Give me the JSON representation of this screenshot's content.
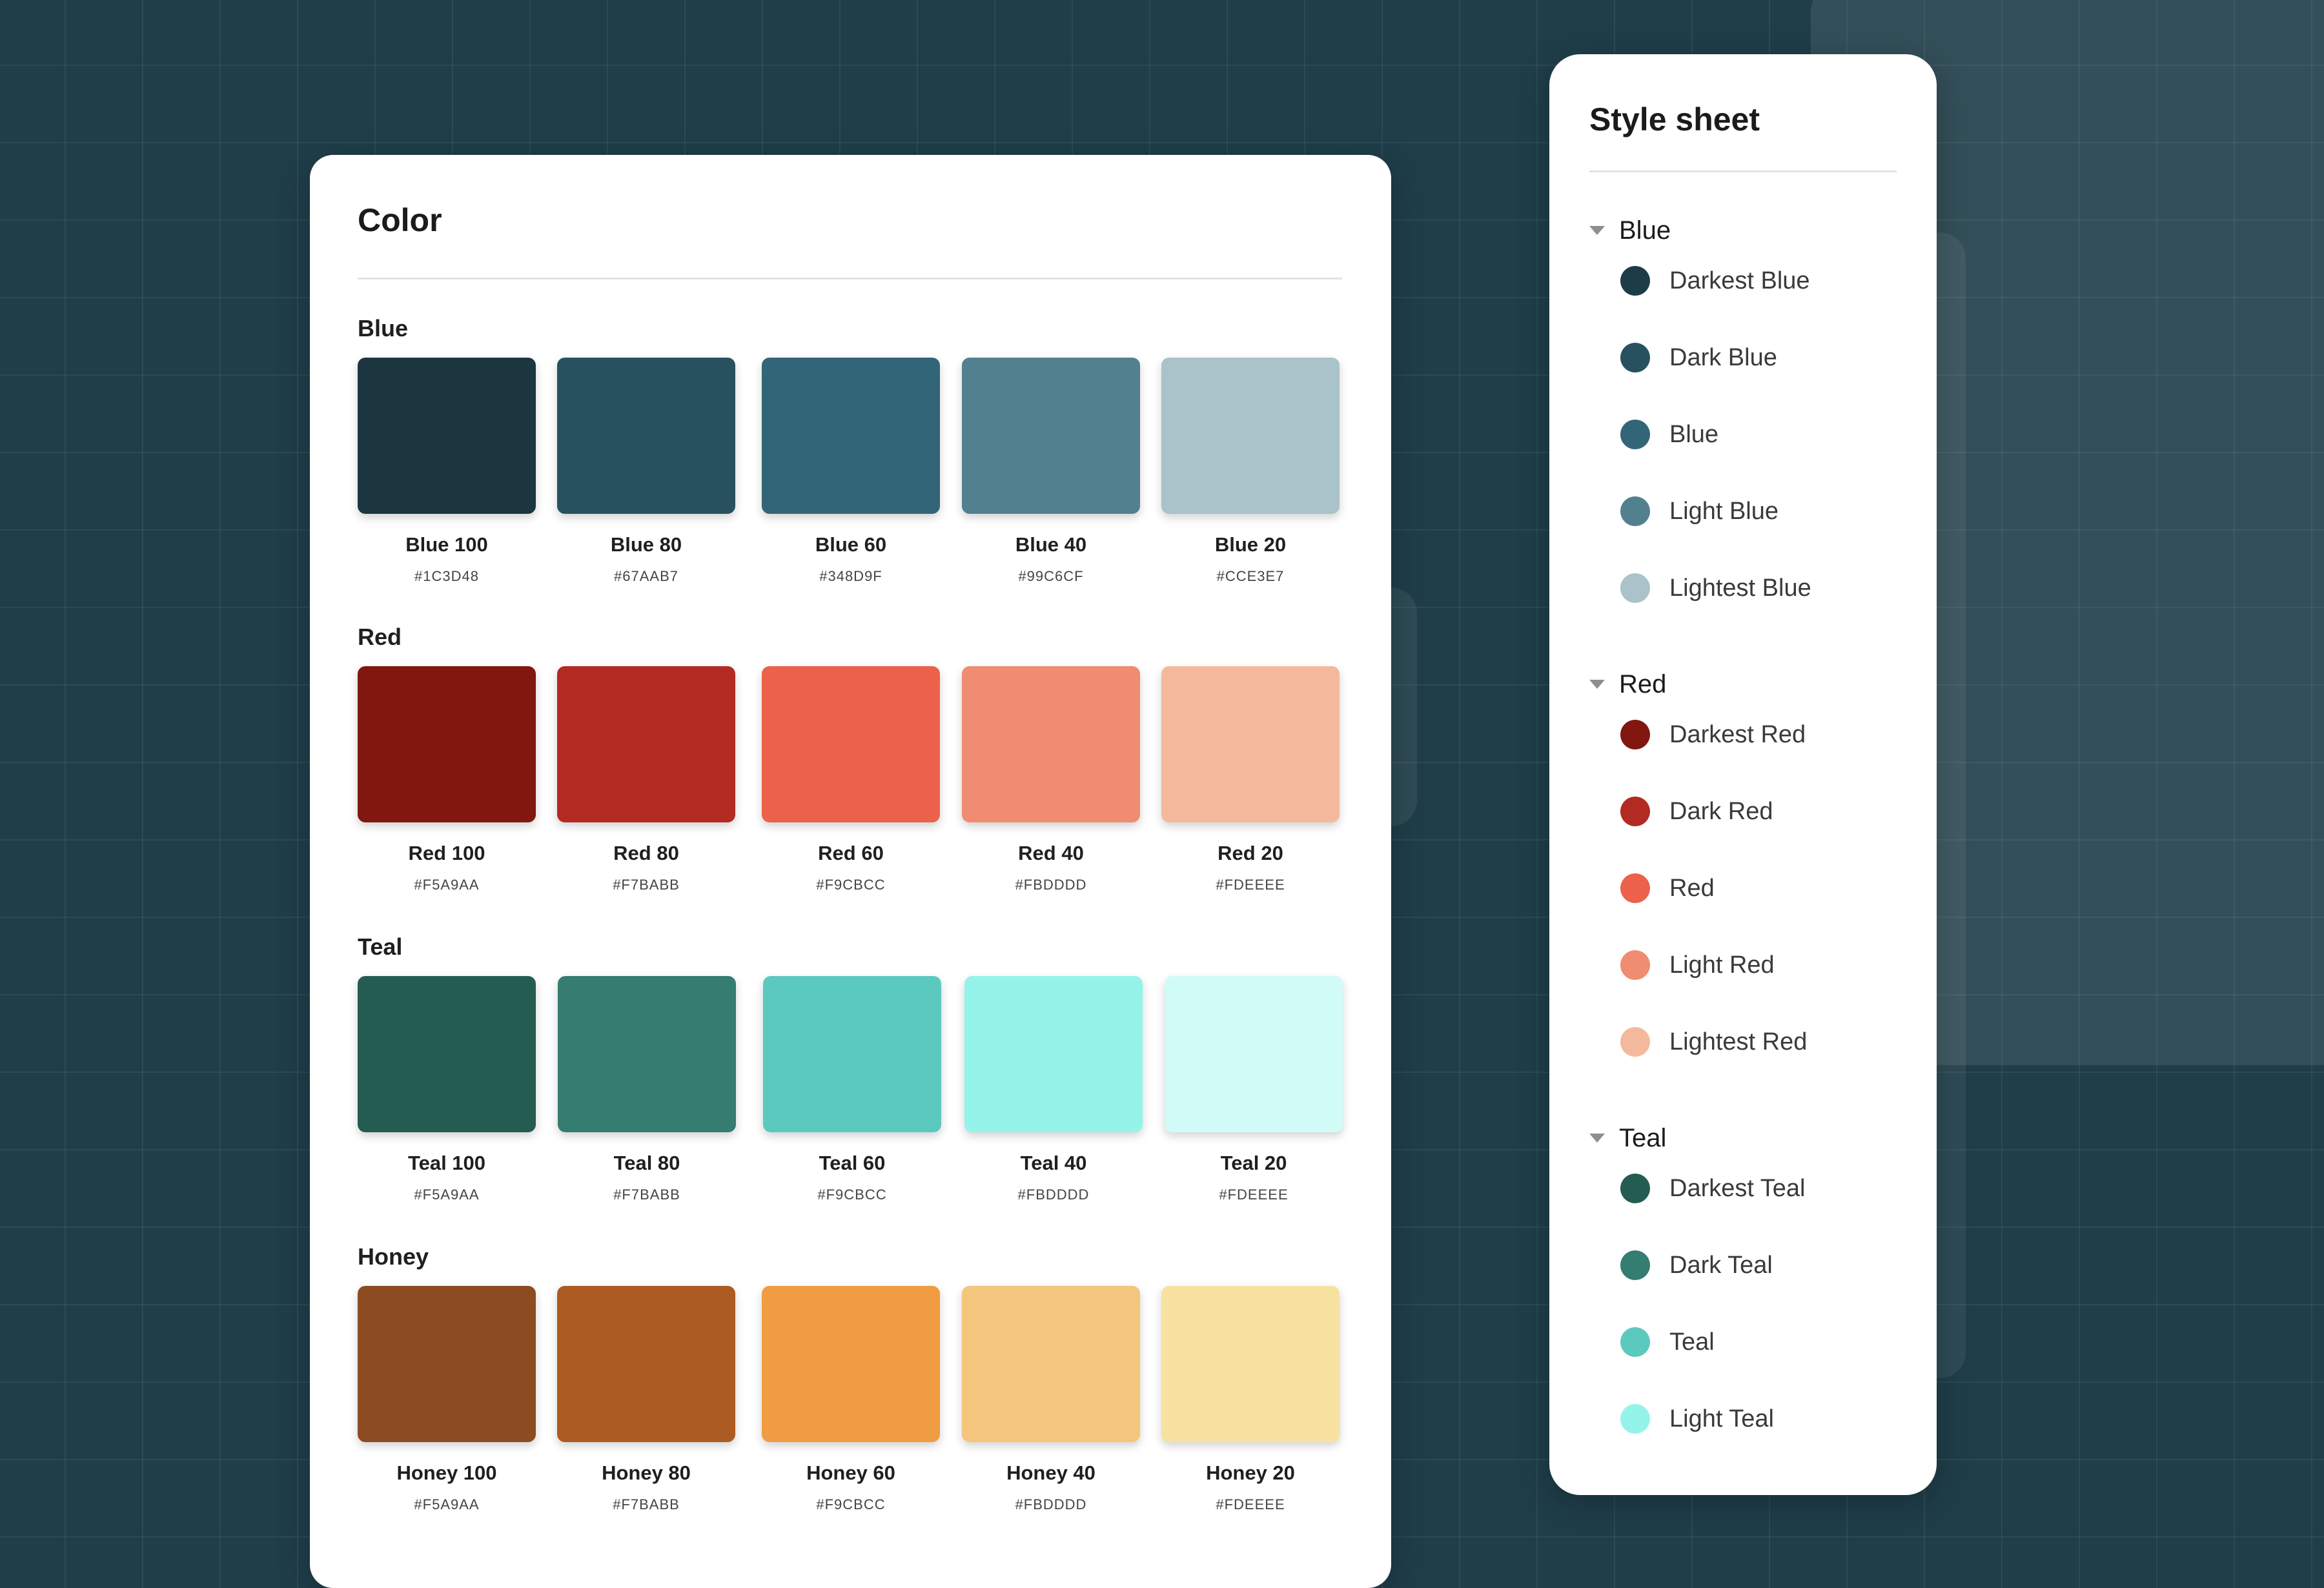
{
  "color_card": {
    "title": "Color",
    "groups": [
      {
        "name": "Blue",
        "swatches": [
          {
            "label": "Blue 100",
            "hex": "#1C3D48",
            "color": "#1c3640"
          },
          {
            "label": "Blue 80",
            "hex": "#67AAB7",
            "color": "#27515e"
          },
          {
            "label": "Blue 60",
            "hex": "#348D9F",
            "color": "#326577"
          },
          {
            "label": "Blue 40",
            "hex": "#99C6CF",
            "color": "#52808f"
          },
          {
            "label": "Blue 20",
            "hex": "#CCE3E7",
            "color": "#aac2c9"
          }
        ]
      },
      {
        "name": "Red",
        "swatches": [
          {
            "label": "Red 100",
            "hex": "#F5A9AA",
            "color": "#81170f"
          },
          {
            "label": "Red 80",
            "hex": "#F7BABB",
            "color": "#b22a22"
          },
          {
            "label": "Red 60",
            "hex": "#F9CBCC",
            "color": "#ec614a"
          },
          {
            "label": "Red 40",
            "hex": "#FBDDDD",
            "color": "#ef8c71"
          },
          {
            "label": "Red 20",
            "hex": "#FDEEEE",
            "color": "#f4b99c"
          }
        ]
      },
      {
        "name": "Teal",
        "swatches": [
          {
            "label": "Teal 100",
            "hex": "#F5A9AA",
            "color": "#255c52"
          },
          {
            "label": "Teal 80",
            "hex": "#F7BABB",
            "color": "#357c71"
          },
          {
            "label": "Teal 60",
            "hex": "#F9CBCC",
            "color": "#5cc9bf"
          },
          {
            "label": "Teal 40",
            "hex": "#FBDDDD",
            "color": "#95f4e9"
          },
          {
            "label": "Teal 20",
            "hex": "#FDEEEE",
            "color": "#d1fbf7"
          }
        ]
      },
      {
        "name": "Honey",
        "swatches": [
          {
            "label": "Honey 100",
            "hex": "#F5A9AA",
            "color": "#8d4b22"
          },
          {
            "label": "Honey 80",
            "hex": "#F7BABB",
            "color": "#ac5b23"
          },
          {
            "label": "Honey 60",
            "hex": "#F9CBCC",
            "color": "#f09c42"
          },
          {
            "label": "Honey 40",
            "hex": "#FBDDDD",
            "color": "#f4c57c"
          },
          {
            "label": "Honey 20",
            "hex": "#FDEEEE",
            "color": "#f8e2a2"
          }
        ]
      }
    ]
  },
  "style_sheet": {
    "title": "Style sheet",
    "groups": [
      {
        "name": "Blue",
        "items": [
          {
            "label": "Darkest Blue",
            "color": "#1c3d48"
          },
          {
            "label": "Dark Blue",
            "color": "#27515e"
          },
          {
            "label": "Blue",
            "color": "#326577"
          },
          {
            "label": "Light Blue",
            "color": "#52808f"
          },
          {
            "label": "Lightest Blue",
            "color": "#aac2c9"
          }
        ]
      },
      {
        "name": "Red",
        "items": [
          {
            "label": "Darkest Red",
            "color": "#81170f"
          },
          {
            "label": "Dark Red",
            "color": "#b22a22"
          },
          {
            "label": "Red",
            "color": "#ec614a"
          },
          {
            "label": "Light Red",
            "color": "#ef8c71"
          },
          {
            "label": "Lightest Red",
            "color": "#f4b99c"
          }
        ]
      },
      {
        "name": "Teal",
        "items": [
          {
            "label": "Darkest Teal",
            "color": "#255c52"
          },
          {
            "label": "Dark Teal",
            "color": "#357c71"
          },
          {
            "label": "Teal",
            "color": "#5cc9bf"
          },
          {
            "label": "Light Teal",
            "color": "#95f4e9"
          }
        ]
      }
    ]
  }
}
